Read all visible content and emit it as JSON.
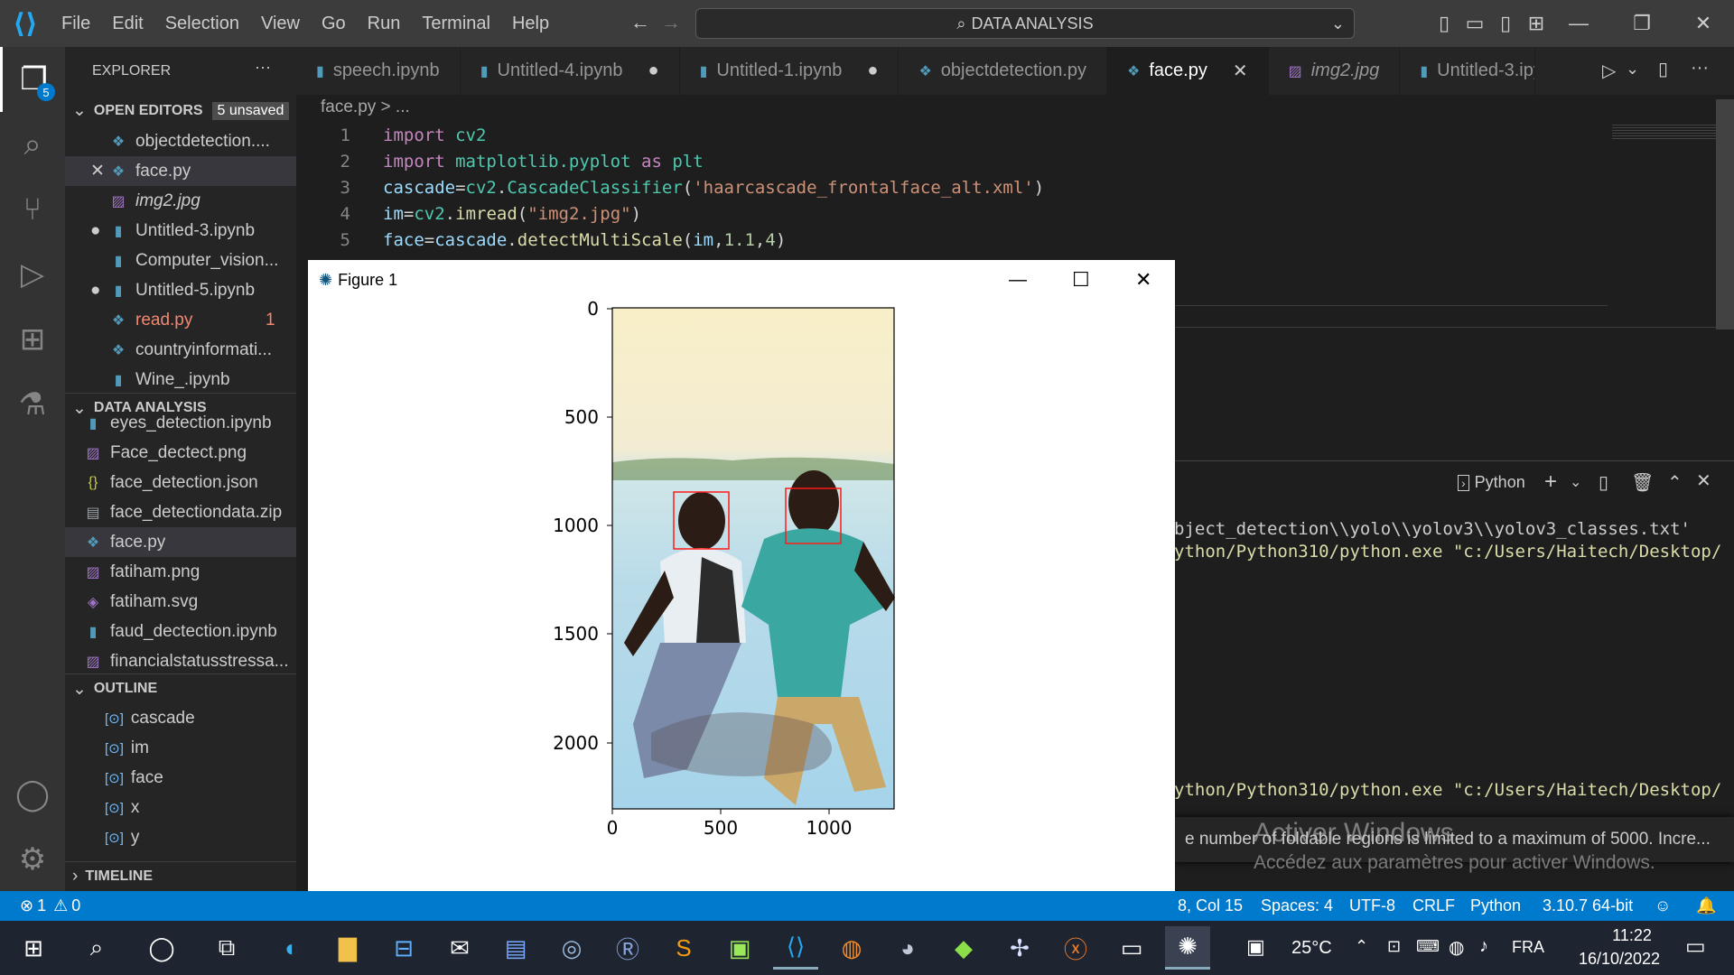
{
  "menu": [
    "File",
    "Edit",
    "Selection",
    "View",
    "Go",
    "Run",
    "Terminal",
    "Help"
  ],
  "command_center": "DATA ANALYSIS",
  "activity_badge": "5",
  "tabs": [
    {
      "label": "speech.ipynb",
      "dirty": ""
    },
    {
      "label": "Untitled-4.ipynb",
      "dirty": "●"
    },
    {
      "label": "Untitled-1.ipynb",
      "dirty": "●"
    },
    {
      "label": "objectdetection.py",
      "dirty": ""
    },
    {
      "label": "face.py",
      "dirty": "✕"
    },
    {
      "label": "img2.jpg",
      "dirty": ""
    },
    {
      "label": "Untitled-3.ipy",
      "dirty": ""
    }
  ],
  "sidebar": {
    "explorer_title": "EXPLORER",
    "open_editors_title": "OPEN EDITORS",
    "unsaved_badge": "5 unsaved",
    "open_editors": [
      {
        "name": "objectdetection....",
        "marker": "",
        "icon": "python-icon",
        "color": "#cccccc"
      },
      {
        "name": "face.py",
        "marker": "✕",
        "icon": "python-icon",
        "color": "#cccccc"
      },
      {
        "name": "img2.jpg",
        "marker": "",
        "icon": "image-icon",
        "color": "#cccccc"
      },
      {
        "name": "Untitled-3.ipynb",
        "marker": "●",
        "icon": "notebook-icon",
        "color": "#cccccc"
      },
      {
        "name": "Computer_vision...",
        "marker": "",
        "icon": "notebook-icon",
        "color": "#cccccc"
      },
      {
        "name": "Untitled-5.ipynb",
        "marker": "●",
        "icon": "notebook-icon",
        "color": "#cccccc"
      },
      {
        "name": "read.py",
        "marker": "",
        "icon": "python-icon",
        "color": "#f48771",
        "count": "1"
      },
      {
        "name": "countryinformati...",
        "marker": "",
        "icon": "python-icon",
        "color": "#cccccc"
      },
      {
        "name": "Wine_.ipynb",
        "marker": "",
        "icon": "notebook-icon",
        "color": "#cccccc"
      }
    ],
    "folder_title": "DATA ANALYSIS",
    "folder_files": [
      {
        "name": "eyes_detection.ipynb",
        "icon": "notebook-icon"
      },
      {
        "name": "Face_dectect.png",
        "icon": "image-icon"
      },
      {
        "name": "face_detection.json",
        "icon": "json-icon"
      },
      {
        "name": "face_detectiondata.zip",
        "icon": "zip-icon"
      },
      {
        "name": "face.py",
        "icon": "python-icon"
      },
      {
        "name": "fatiham.png",
        "icon": "image-icon"
      },
      {
        "name": "fatiham.svg",
        "icon": "svg-icon"
      },
      {
        "name": "faud_dectection.ipynb",
        "icon": "notebook-icon"
      },
      {
        "name": "financialstatusstressa...",
        "icon": "image-icon"
      }
    ],
    "outline_title": "OUTLINE",
    "outline_items": [
      "cascade",
      "im",
      "face",
      "x",
      "y"
    ],
    "timeline_title": "TIMELINE"
  },
  "breadcrumb": "face.py > ...",
  "code": {
    "line_numbers": [
      "1",
      "2",
      "3",
      "4",
      "5"
    ]
  },
  "figure": {
    "title": "Figure 1",
    "y_ticks": [
      "0",
      "500",
      "1000",
      "1500",
      "2000"
    ],
    "x_ticks": [
      "0",
      "500",
      "1000"
    ]
  },
  "panel": {
    "terminal_label": "Python",
    "lines": [
      "bject_detection\\\\yolo\\\\yolov3\\\\yolov3_classes.txt'",
      "ython/Python310/python.exe \"c:/Users/Haitech/Desktop/",
      "ython/Python310/python.exe \"c:/Users/Haitech/Desktop/"
    ]
  },
  "notification": "e number of foldable regions is limited to a maximum of 5000. Incre...",
  "watermark": {
    "line1": "Activer Windows",
    "line2": "Accédez aux paramètres pour activer Windows."
  },
  "status": {
    "errors": "1",
    "warnings": "0",
    "position": "8, Col 15",
    "spaces": "Spaces: 4",
    "encoding": "UTF-8",
    "eol": "CRLF",
    "language": "Python",
    "interpreter": "3.10.7 64-bit"
  },
  "taskbar": {
    "temperature": "25°C",
    "language": "FRA",
    "time": "11:22",
    "date": "16/10/2022"
  }
}
